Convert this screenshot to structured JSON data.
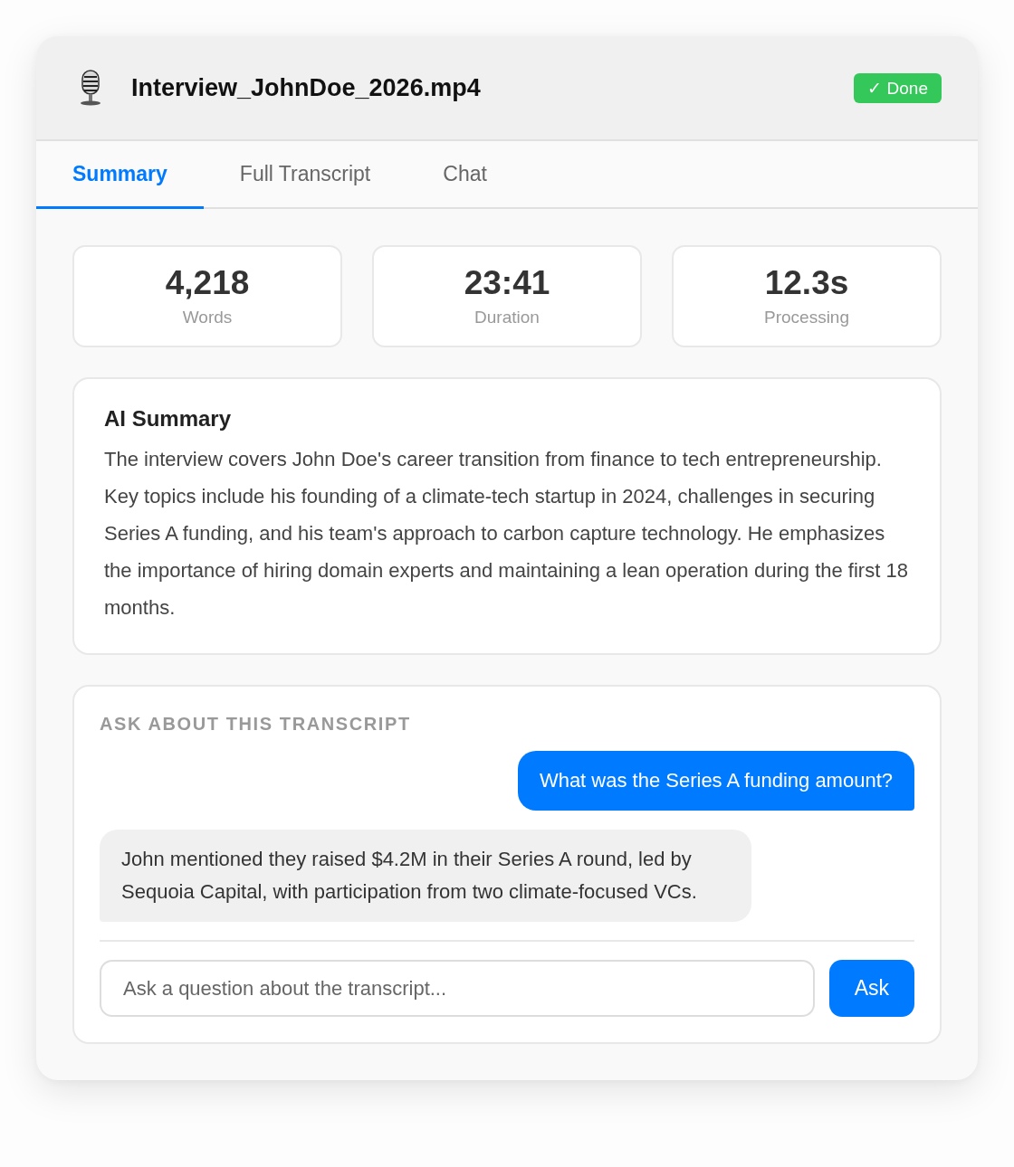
{
  "window": {
    "title": "Interview_JohnDoe_2026.mp4",
    "status": {
      "label": "✓ Done",
      "kind": "success"
    }
  },
  "tabs": [
    {
      "label": "Summary",
      "selected": true
    },
    {
      "label": "Full Transcript",
      "selected": false
    },
    {
      "label": "Chat",
      "selected": false
    }
  ],
  "stats": [
    {
      "value": "4,218",
      "label": "Words"
    },
    {
      "value": "23:41",
      "label": "Duration"
    },
    {
      "value": "12.3s",
      "label": "Processing"
    }
  ],
  "summary": {
    "title": "AI Summary",
    "text": "The interview covers John Doe's career transition from finance to tech entrepreneurship. Key topics include his founding of a climate-tech startup in 2024, challenges in securing Series A funding, and his team's approach to carbon capture technology. He emphasizes the importance of hiring domain experts and maintaining a lean operation during the first 18 months."
  },
  "chat": {
    "heading": "ASK ABOUT THIS TRANSCRIPT",
    "messages": [
      {
        "kind": "user",
        "text": "What was the Series A funding amount?"
      },
      {
        "kind": "assistant",
        "text": "John mentioned they raised $4.2M in their Series A round, led by Sequoia Capital, with participation from two climate-focused VCs."
      }
    ],
    "input": {
      "placeholder": "Ask a question about the transcript..."
    },
    "button": "Ask"
  }
}
